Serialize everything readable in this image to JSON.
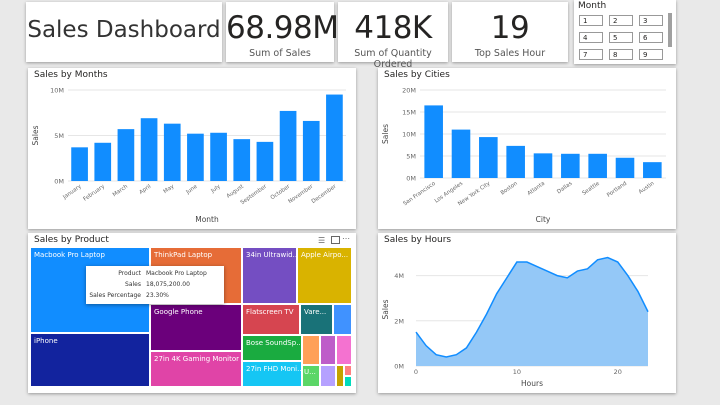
{
  "title": "Sales Dashboard",
  "kpis": [
    {
      "value": "68.98M",
      "label": "Sum of Sales"
    },
    {
      "value": "418K",
      "label": "Sum of Quantity Ordered"
    },
    {
      "value": "19",
      "label": "Top Sales Hour"
    }
  ],
  "slicer": {
    "title": "Month",
    "options": [
      "1",
      "2",
      "3",
      "4",
      "5",
      "6",
      "7",
      "8",
      "9"
    ]
  },
  "colors": {
    "bar": "#118dff",
    "area": "#94c8f7",
    "line": "#118dff"
  },
  "months_panel": {
    "title": "Sales by Months"
  },
  "cities_panel": {
    "title": "Sales by Cities"
  },
  "product_panel": {
    "title": "Sales by Product"
  },
  "hours_panel": {
    "title": "Sales by Hours"
  },
  "treemap": [
    {
      "label": "Macbook Pro Laptop",
      "color": "#118dff"
    },
    {
      "label": "iPhone",
      "color": "#12239e"
    },
    {
      "label": "ThinkPad Laptop",
      "color": "#e66c37"
    },
    {
      "label": "Google Phone",
      "color": "#6b007b"
    },
    {
      "label": "27in 4K Gaming Monitor",
      "color": "#e044a7"
    },
    {
      "label": "34in Ultrawid...",
      "color": "#744ec2"
    },
    {
      "label": "Apple Airpo...",
      "color": "#d9b300"
    },
    {
      "label": "Flatscreen TV",
      "color": "#d64550"
    },
    {
      "label": "Vare...",
      "color": "#197278"
    },
    {
      "label": "Bose SoundSp...",
      "color": "#1aab40"
    },
    {
      "label": "27in FHD Moni...",
      "color": "#15c6f4"
    },
    {
      "label": "",
      "color": "#4092ff"
    },
    {
      "label": "",
      "color": "#ffa058"
    },
    {
      "label": "",
      "color": "#be5dc9"
    },
    {
      "label": "",
      "color": "#f472d0"
    },
    {
      "label": "",
      "color": "#b5a1ff"
    },
    {
      "label": "",
      "color": "#c4a200"
    },
    {
      "label": "",
      "color": "#ff8080"
    },
    {
      "label": "",
      "color": "#00dbbc"
    },
    {
      "label": "U...",
      "color": "#5bd667"
    },
    {
      "label": "",
      "color": "#0091d5"
    }
  ],
  "tooltip": {
    "rows": [
      {
        "key": "Product",
        "value": "Macbook Pro Laptop"
      },
      {
        "key": "Sales",
        "value": "18,075,200.00"
      },
      {
        "key": "Sales Percentage",
        "value": "23.30%"
      }
    ]
  },
  "chart_data": [
    {
      "type": "bar",
      "title": "Sales by Months",
      "xlabel": "Month",
      "ylabel": "Sales",
      "categories": [
        "January",
        "February",
        "March",
        "April",
        "May",
        "June",
        "July",
        "August",
        "September",
        "October",
        "November",
        "December"
      ],
      "values": [
        3.7,
        4.2,
        5.7,
        6.9,
        6.3,
        5.2,
        5.3,
        4.6,
        4.3,
        7.7,
        6.6,
        9.5
      ],
      "ylim": [
        0,
        10
      ],
      "yticks": [
        "0M",
        "5M",
        "10M"
      ],
      "grid": true
    },
    {
      "type": "bar",
      "title": "Sales by Cities",
      "xlabel": "City",
      "ylabel": "Sales",
      "categories": [
        "San Francisco",
        "Los Angeles",
        "New York City",
        "Boston",
        "Atlanta",
        "Dallas",
        "Seattle",
        "Portland",
        "Austin"
      ],
      "values": [
        16.5,
        11.0,
        9.3,
        7.3,
        5.6,
        5.5,
        5.5,
        4.6,
        3.6
      ],
      "ylim": [
        0,
        20
      ],
      "yticks": [
        "0M",
        "5M",
        "10M",
        "15M",
        "20M"
      ],
      "grid": true
    },
    {
      "type": "area",
      "title": "Sales by Hours",
      "xlabel": "Hours",
      "ylabel": "Sales",
      "x": [
        0,
        1,
        2,
        3,
        4,
        5,
        6,
        7,
        8,
        9,
        10,
        11,
        12,
        13,
        14,
        15,
        16,
        17,
        18,
        19,
        20,
        21,
        22,
        23
      ],
      "values": [
        1.5,
        0.9,
        0.5,
        0.4,
        0.5,
        0.8,
        1.5,
        2.3,
        3.2,
        3.9,
        4.6,
        4.6,
        4.4,
        4.2,
        4.0,
        3.9,
        4.2,
        4.3,
        4.7,
        4.8,
        4.6,
        4.0,
        3.3,
        2.4
      ],
      "ylim": [
        0,
        5
      ],
      "yticks": [
        "0M",
        "2M",
        "4M"
      ],
      "xticks": [
        "0",
        "10",
        "20"
      ],
      "grid": true
    }
  ]
}
